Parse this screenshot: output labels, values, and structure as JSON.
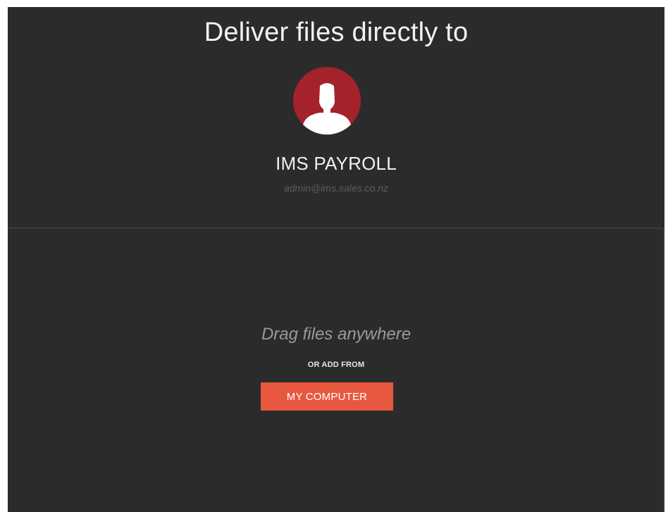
{
  "header": {
    "title": "Deliver files directly to"
  },
  "recipient": {
    "avatar_icon": "user-silhouette-icon",
    "avatar_color": "#a4222a",
    "name": "IMS PAYROLL",
    "email": "admin@ims.sales.co.nz"
  },
  "dropzone": {
    "drag_text": "Drag files anywhere",
    "or_text": "OR ADD FROM",
    "button_label": "MY COMPUTER",
    "button_color": "#e8583f"
  },
  "colors": {
    "background": "#2b2b2b"
  }
}
